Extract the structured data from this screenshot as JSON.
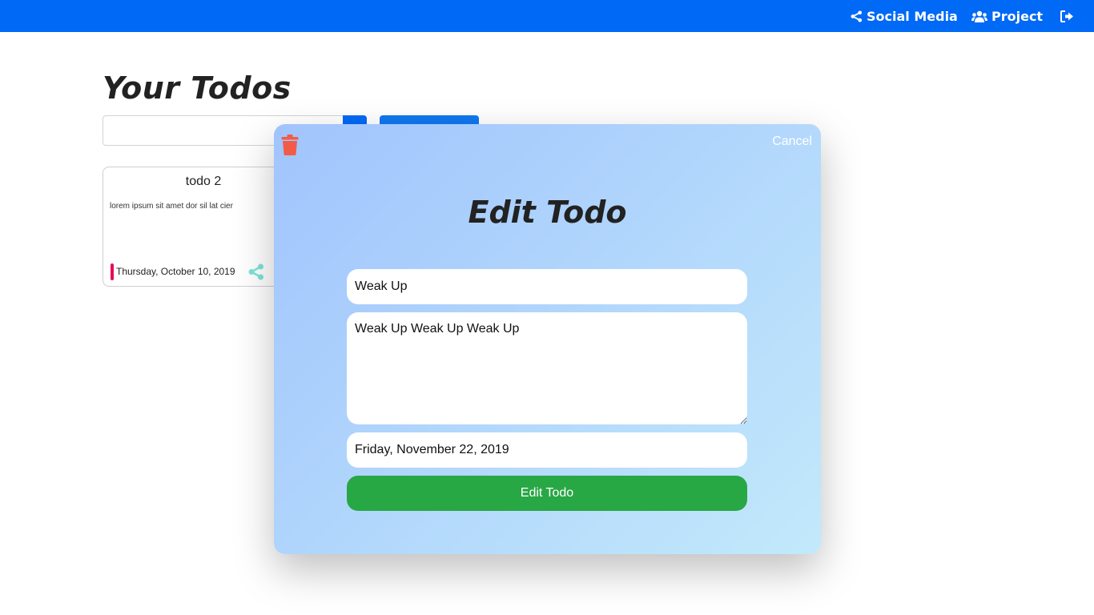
{
  "navbar": {
    "items": [
      {
        "label": "Social Media",
        "icon": "share-icon"
      },
      {
        "label": "Project",
        "icon": "users-icon"
      },
      {
        "label": "",
        "icon": "sign-out-icon"
      }
    ]
  },
  "main": {
    "title": "Your Todos",
    "search": {
      "value": "",
      "placeholder": ""
    }
  },
  "todo_card": {
    "title": "todo 2",
    "description": "lorem ipsum sit amet dor sil lat cier",
    "date": "Thursday, October 10, 2019",
    "accent_color": "#e8095e",
    "share_icon": "share-icon"
  },
  "modal": {
    "cancel_label": "Cancel",
    "title": "Edit Todo",
    "todo_title": "Weak Up",
    "todo_description": "Weak Up Weak Up Weak Up",
    "todo_date": "Friday, November 22, 2019",
    "submit_label": "Edit Todo",
    "delete_icon": "trash-icon"
  },
  "colors": {
    "navbar": "#0069f6",
    "submit": "#28a745",
    "trash": "#f25c47",
    "share": "#7de3d8"
  }
}
